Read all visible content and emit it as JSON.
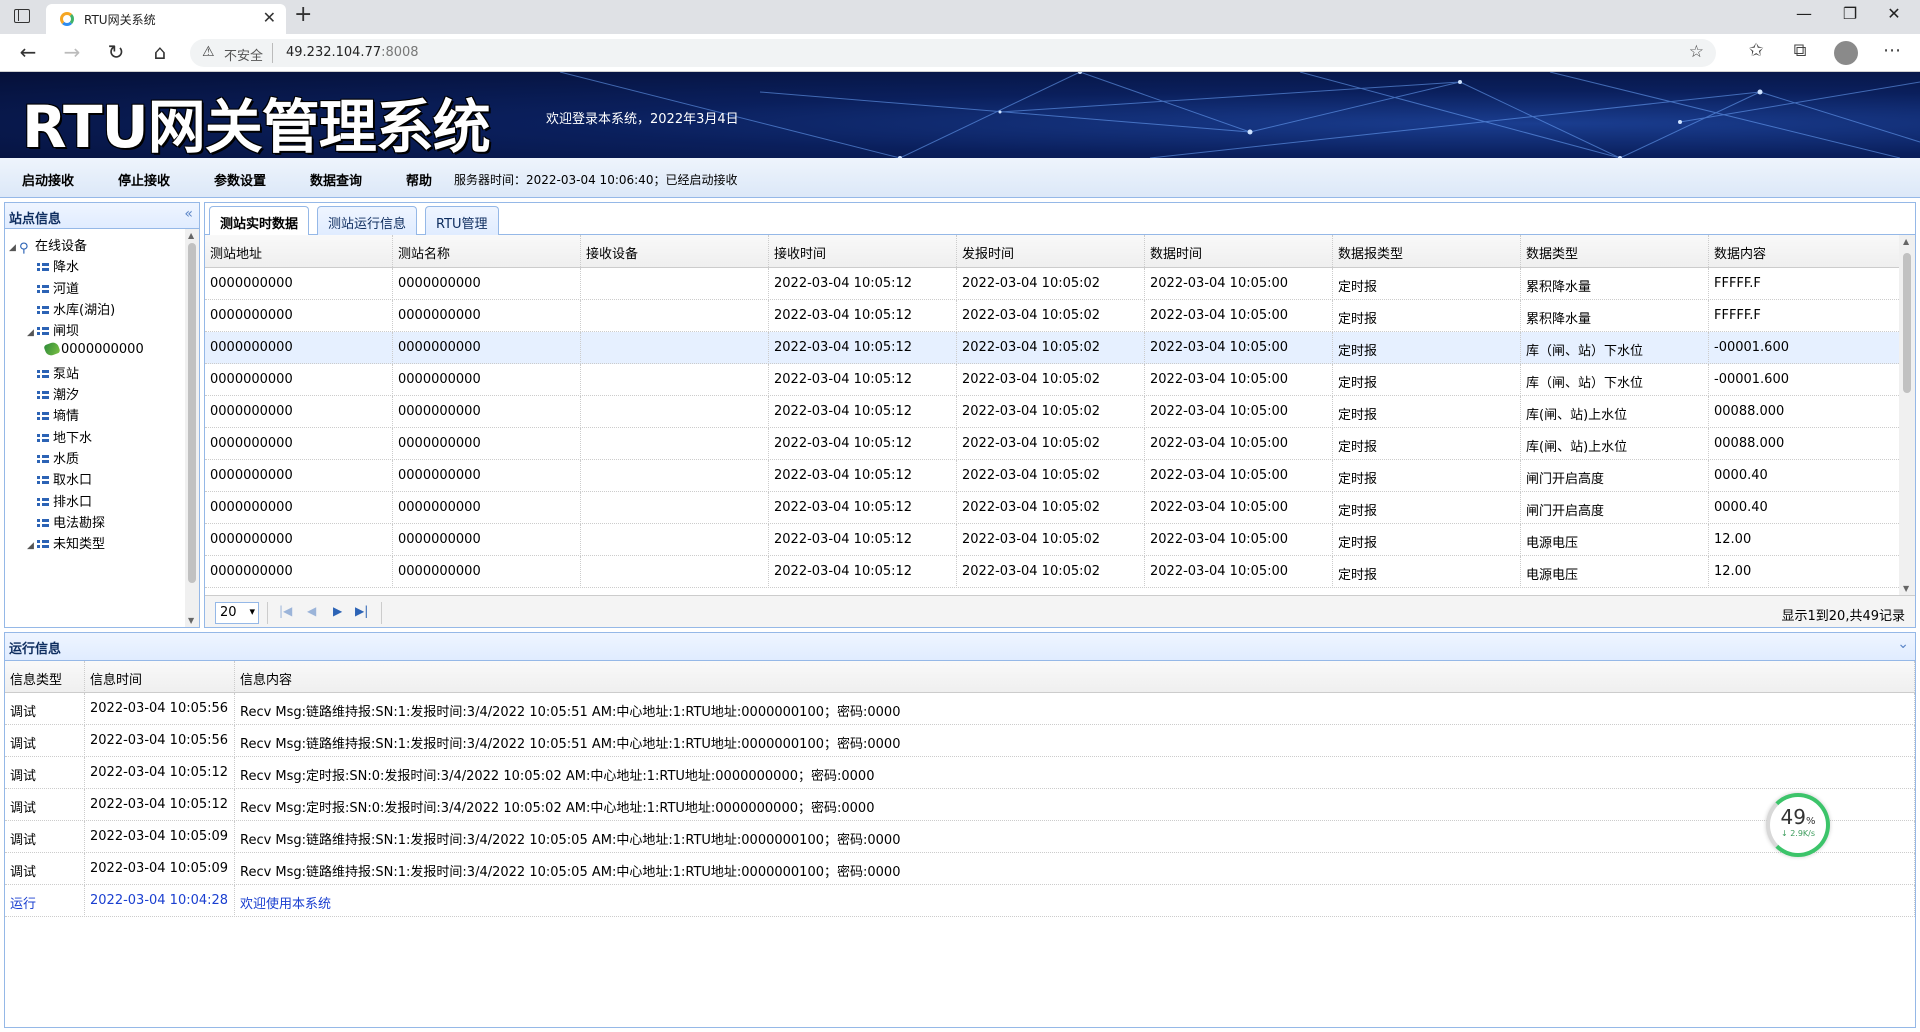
{
  "browser": {
    "tab_title": "RTU网关系统",
    "insecure_label": "不安全",
    "url_host": "49.232.104.77",
    "url_port": ":8008"
  },
  "app": {
    "title": "RTU网关管理系统",
    "welcome": "欢迎登录本系统，2022年3月4日"
  },
  "menu": {
    "items": [
      "启动接收",
      "停止接收",
      "参数设置",
      "数据查询",
      "帮助"
    ],
    "server_time": "服务器时间：2022-03-04 10:06:40；已经启动接收"
  },
  "left_panel": {
    "title": "站点信息",
    "tree": [
      {
        "label": "在线设备",
        "level": 0,
        "kind": "root",
        "expanded": true
      },
      {
        "label": "降水",
        "level": 1,
        "kind": "group"
      },
      {
        "label": "河道",
        "level": 1,
        "kind": "group"
      },
      {
        "label": "水库(湖泊)",
        "level": 1,
        "kind": "group"
      },
      {
        "label": "闸坝",
        "level": 1,
        "kind": "group",
        "expanded": true
      },
      {
        "label": "0000000000",
        "level": 2,
        "kind": "device"
      },
      {
        "label": "泵站",
        "level": 1,
        "kind": "group"
      },
      {
        "label": "潮汐",
        "level": 1,
        "kind": "group"
      },
      {
        "label": "墒情",
        "level": 1,
        "kind": "group"
      },
      {
        "label": "地下水",
        "level": 1,
        "kind": "group"
      },
      {
        "label": "水质",
        "level": 1,
        "kind": "group"
      },
      {
        "label": "取水口",
        "level": 1,
        "kind": "group"
      },
      {
        "label": "排水口",
        "level": 1,
        "kind": "group"
      },
      {
        "label": "电法勘探",
        "level": 1,
        "kind": "group"
      },
      {
        "label": "未知类型",
        "level": 1,
        "kind": "group",
        "expanded": true
      }
    ]
  },
  "tabs": [
    {
      "label": "测站实时数据",
      "active": true
    },
    {
      "label": "测站运行信息",
      "active": false
    },
    {
      "label": "RTU管理",
      "active": false
    }
  ],
  "grid": {
    "columns": [
      "测站地址",
      "测站名称",
      "接收设备",
      "接收时间",
      "发报时间",
      "数据时间",
      "数据报类型",
      "数据类型",
      "数据内容"
    ],
    "rows": [
      [
        "0000000000",
        "0000000000",
        "",
        "2022-03-04 10:05:12",
        "2022-03-04 10:05:02",
        "2022-03-04 10:05:00",
        "定时报",
        "累积降水量",
        "FFFFF.F"
      ],
      [
        "0000000000",
        "0000000000",
        "",
        "2022-03-04 10:05:12",
        "2022-03-04 10:05:02",
        "2022-03-04 10:05:00",
        "定时报",
        "累积降水量",
        "FFFFF.F"
      ],
      [
        "0000000000",
        "0000000000",
        "",
        "2022-03-04 10:05:12",
        "2022-03-04 10:05:02",
        "2022-03-04 10:05:00",
        "定时报",
        "库（闸、站）下水位",
        "-00001.600"
      ],
      [
        "0000000000",
        "0000000000",
        "",
        "2022-03-04 10:05:12",
        "2022-03-04 10:05:02",
        "2022-03-04 10:05:00",
        "定时报",
        "库（闸、站）下水位",
        "-00001.600"
      ],
      [
        "0000000000",
        "0000000000",
        "",
        "2022-03-04 10:05:12",
        "2022-03-04 10:05:02",
        "2022-03-04 10:05:00",
        "定时报",
        "库(闸、站)上水位",
        "00088.000"
      ],
      [
        "0000000000",
        "0000000000",
        "",
        "2022-03-04 10:05:12",
        "2022-03-04 10:05:02",
        "2022-03-04 10:05:00",
        "定时报",
        "库(闸、站)上水位",
        "00088.000"
      ],
      [
        "0000000000",
        "0000000000",
        "",
        "2022-03-04 10:05:12",
        "2022-03-04 10:05:02",
        "2022-03-04 10:05:00",
        "定时报",
        "闸门开启高度",
        "0000.40"
      ],
      [
        "0000000000",
        "0000000000",
        "",
        "2022-03-04 10:05:12",
        "2022-03-04 10:05:02",
        "2022-03-04 10:05:00",
        "定时报",
        "闸门开启高度",
        "0000.40"
      ],
      [
        "0000000000",
        "0000000000",
        "",
        "2022-03-04 10:05:12",
        "2022-03-04 10:05:02",
        "2022-03-04 10:05:00",
        "定时报",
        "电源电压",
        "12.00"
      ],
      [
        "0000000000",
        "0000000000",
        "",
        "2022-03-04 10:05:12",
        "2022-03-04 10:05:02",
        "2022-03-04 10:05:00",
        "定时报",
        "电源电压",
        "12.00"
      ]
    ],
    "selected_row": 2
  },
  "pager": {
    "page_size": "20",
    "info": "显示1到20,共49记录"
  },
  "log_panel": {
    "title": "运行信息",
    "columns": [
      "信息类型",
      "信息时间",
      "信息内容"
    ],
    "rows": [
      [
        "调试",
        "2022-03-04 10:05:56",
        "Recv Msg:链路维持报:SN:1:发报时间:3/4/2022 10:05:51 AM:中心地址:1:RTU地址:0000000100；密码:0000"
      ],
      [
        "调试",
        "2022-03-04 10:05:56",
        "Recv Msg:链路维持报:SN:1:发报时间:3/4/2022 10:05:51 AM:中心地址:1:RTU地址:0000000100；密码:0000"
      ],
      [
        "调试",
        "2022-03-04 10:05:12",
        "Recv Msg:定时报:SN:0:发报时间:3/4/2022 10:05:02 AM:中心地址:1:RTU地址:0000000000；密码:0000"
      ],
      [
        "调试",
        "2022-03-04 10:05:12",
        "Recv Msg:定时报:SN:0:发报时间:3/4/2022 10:05:02 AM:中心地址:1:RTU地址:0000000000；密码:0000"
      ],
      [
        "调试",
        "2022-03-04 10:05:09",
        "Recv Msg:链路维持报:SN:1:发报时间:3/4/2022 10:05:05 AM:中心地址:1:RTU地址:0000000100；密码:0000"
      ],
      [
        "调试",
        "2022-03-04 10:05:09",
        "Recv Msg:链路维持报:SN:1:发报时间:3/4/2022 10:05:05 AM:中心地址:1:RTU地址:0000000100；密码:0000"
      ],
      [
        "运行",
        "2022-03-04 10:04:28",
        "欢迎使用本系统"
      ]
    ],
    "highlight_row": 6,
    "highlight_color": "#1a3fd0"
  },
  "speed_widget": {
    "percent": "49",
    "unit": "%",
    "rate": "↓ 2.9K/s"
  },
  "colors": {
    "panel_border": "#95b8e7",
    "header_bg": "#0a1f5c",
    "accent_green": "#3cc46a"
  }
}
